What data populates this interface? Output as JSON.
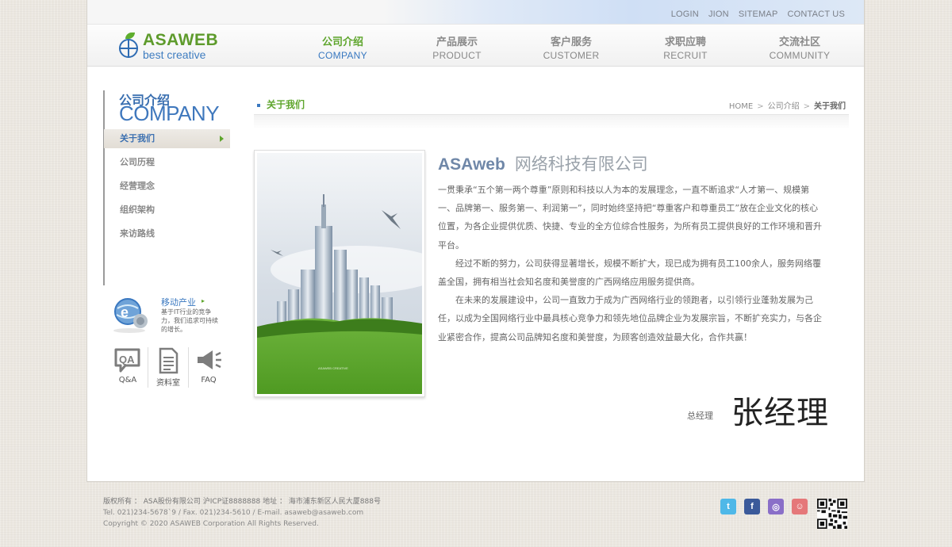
{
  "top_links": [
    "LOGIN",
    "JION",
    "SITEMAP",
    "CONTACT US"
  ],
  "logo": {
    "name": "ASAWEB",
    "sub": "best creative"
  },
  "nav": [
    {
      "cn": "公司介绍",
      "en": "COMPANY"
    },
    {
      "cn": "产品展示",
      "en": "PRODUCT"
    },
    {
      "cn": "客户服务",
      "en": "CUSTOMER"
    },
    {
      "cn": "求职应聘",
      "en": "RECRUIT"
    },
    {
      "cn": "交流社区",
      "en": "COMMUNITY"
    }
  ],
  "sidebar": {
    "title_cn": "公司介绍",
    "title_en": "COMPANY",
    "items": [
      "关于我们",
      "公司历程",
      "经营理念",
      "组织架构",
      "来访路线"
    ]
  },
  "mobile": {
    "title": "移动产业",
    "desc": "基于IT行业的竞争力，我们追求可持续的增长。"
  },
  "quick_links": [
    "Q&A",
    "资料室",
    "FAQ"
  ],
  "section": {
    "title": "关于我们",
    "breadcrumb": [
      "HOME",
      "公司介绍",
      "关于我们"
    ]
  },
  "company": {
    "brand": "ASAweb",
    "name": "网络科技有限公司"
  },
  "intro": [
    "一贯秉承“五个第一两个尊重”原则和科技以人为本的发展理念，一直不断追求“人才第一、规模第一、品牌第一、服务第一、利润第一”，同时始终坚持把“尊重客户和尊重员工”放在企业文化的核心位置，为各企业提供优质、快捷、专业的全方位综合性服务，为所有员工提供良好的工作环境和晋升平台。",
    "经过不断的努力，公司获得显著增长，规模不断扩大，现已成为拥有员工100余人，服务网络覆盖全国，拥有相当社会知名度和美誉度的广西网络应用服务提供商。",
    "在未来的发展建设中，公司一直致力于成为广西网络行业的领跑者，以引领行业蓬勃发展为己任，以成为全国网络行业中最具核心竞争力和领先地位品牌企业为发展宗旨，不断扩充实力，与各企业紧密合作，提高公司品牌知名度和美誉度，为顾客创造效益最大化，合作共赢！"
  ],
  "signer": {
    "role": "总经理",
    "name": "张经理"
  },
  "footer": {
    "line1": "版权所有 ： ASA股份有限公司  沪ICP证8888888    地址 ： 海市浦东新区人民大厦888号",
    "line2": "Tel. 021)234-5678`9  / Fax. 021)234-5610  / E-mail. asaweb@asaweb.com",
    "line3": "Copyright © 2020 ASAWEB Corporation All Rights Reserved."
  },
  "social": [
    "twitter-icon",
    "facebook-icon",
    "blog-icon",
    "me2day-icon"
  ],
  "colors": {
    "green": "#5ea52c",
    "blue": "#3a78c0"
  }
}
